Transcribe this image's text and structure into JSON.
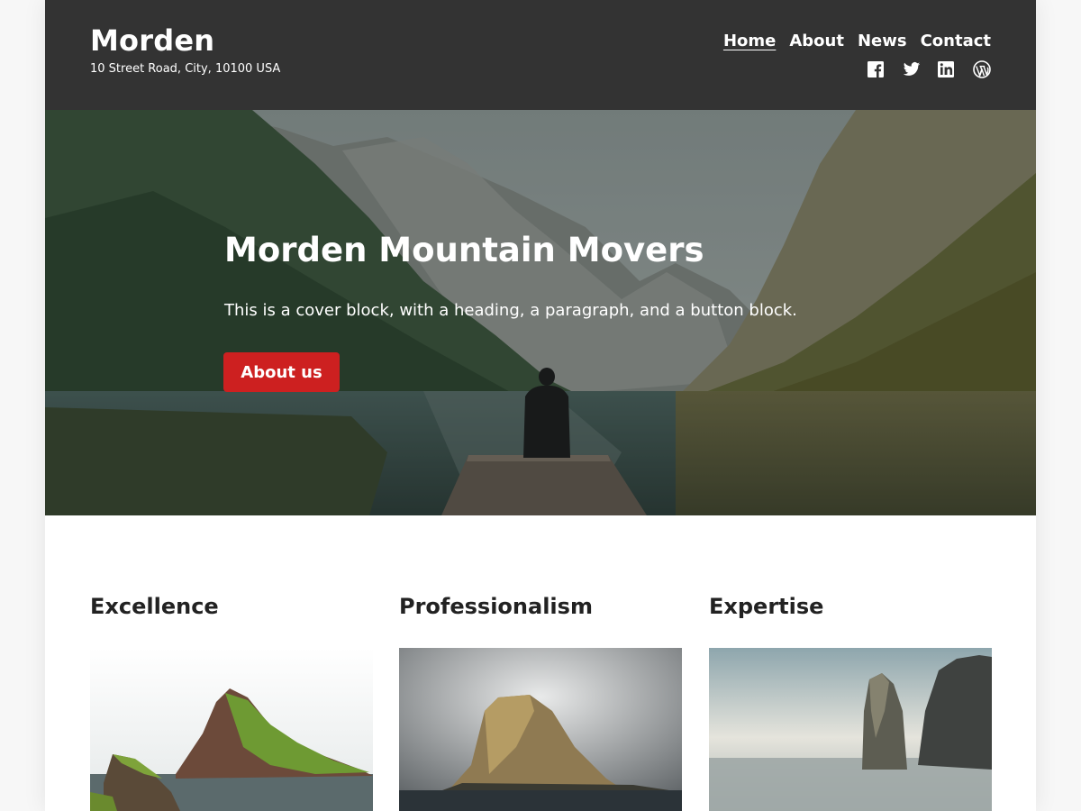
{
  "site": {
    "title": "Morden",
    "address": "10 Street Road, City, 10100 USA"
  },
  "nav": {
    "items": [
      {
        "label": "Home",
        "current": true
      },
      {
        "label": "About",
        "current": false
      },
      {
        "label": "News",
        "current": false
      },
      {
        "label": "Contact",
        "current": false
      }
    ]
  },
  "social": [
    "facebook-icon",
    "twitter-icon",
    "linkedin-icon",
    "wordpress-icon"
  ],
  "cover": {
    "heading": "Morden Mountain Movers",
    "text": "This is a cover block, with a heading, a paragraph, and a button block.",
    "button": "About us"
  },
  "columns": [
    {
      "heading": "Excellence",
      "image": "green-island-cliffs-photo"
    },
    {
      "heading": "Professionalism",
      "image": "rock-island-stormy-sky-photo"
    },
    {
      "heading": "Expertise",
      "image": "sea-stacks-calm-water-photo"
    }
  ],
  "colors": {
    "header_bg": "#333333",
    "accent_button": "#cd2020",
    "text_dark": "#222222"
  }
}
